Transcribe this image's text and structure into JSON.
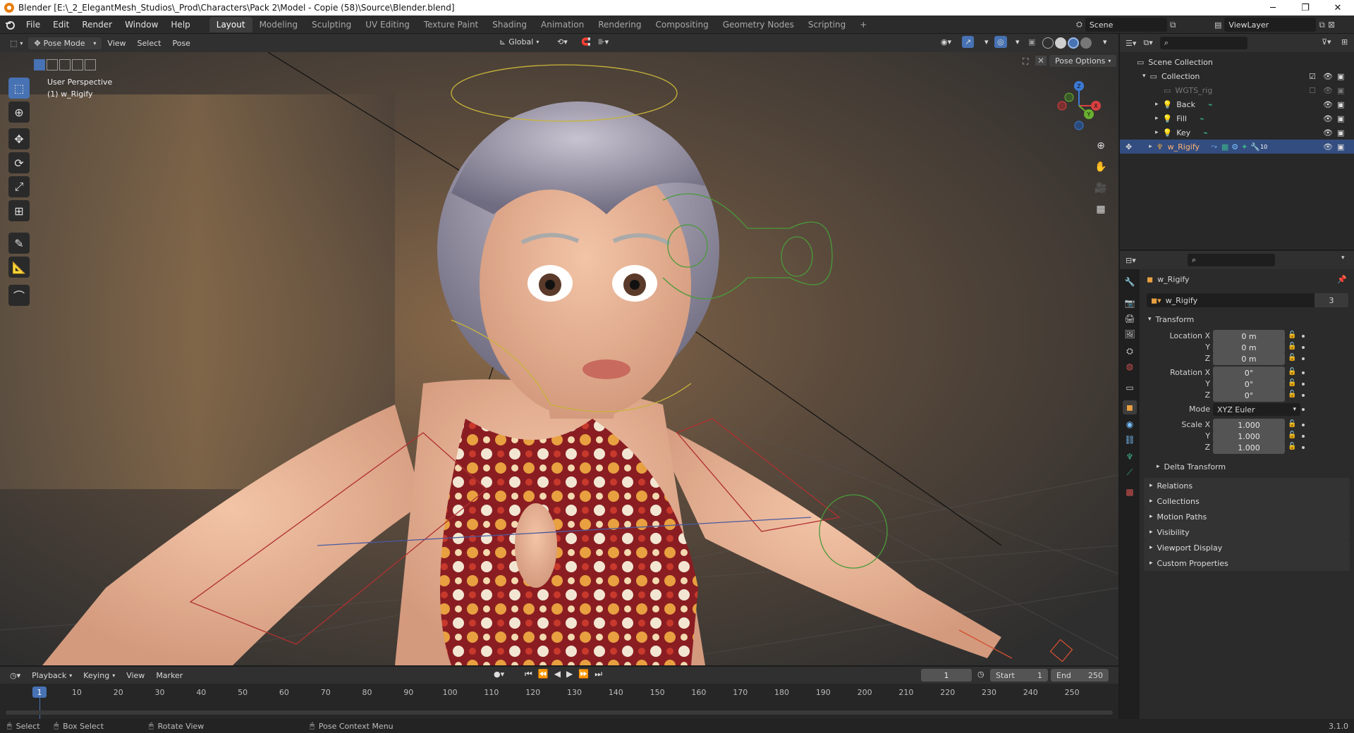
{
  "window": {
    "title": "Blender [E:\\_2_ElegantMesh_Studios\\_Prod\\Characters\\Pack 2\\Model - Copie (58)\\Source\\Blender.blend]",
    "minimize": "─",
    "maximize": "❐",
    "close": "✕"
  },
  "menubar": {
    "menus": [
      "File",
      "Edit",
      "Render",
      "Window",
      "Help"
    ],
    "workspaces": [
      "Layout",
      "Modeling",
      "Sculpting",
      "UV Editing",
      "Texture Paint",
      "Shading",
      "Animation",
      "Rendering",
      "Compositing",
      "Geometry Nodes",
      "Scripting"
    ],
    "active_workspace": "Layout",
    "add_workspace": "+",
    "scene_label": "Scene",
    "view_layer_label": "ViewLayer"
  },
  "viewport_header": {
    "mode": "Pose Mode",
    "menus": [
      "View",
      "Select",
      "Pose"
    ],
    "orientation": "Global",
    "pose_options": "Pose Options"
  },
  "viewport": {
    "perspective_label": "User Perspective",
    "object_label": "(1) w_Rigify",
    "gizmo_axes": [
      "X",
      "Y",
      "Z"
    ]
  },
  "outliner": {
    "root": "Scene Collection",
    "collection": "Collection",
    "items": [
      "WGTS_rig",
      "Back",
      "Fill",
      "Key",
      "w_Rigify"
    ],
    "selected": "w_Rigify",
    "modifier_count": "10"
  },
  "properties": {
    "object_name": "w_Rigify",
    "data_name": "w_Rigify",
    "users": "3",
    "transform_label": "Transform",
    "location_label": "Location X",
    "rotation_label": "Rotation X",
    "scale_label": "Scale X",
    "axis_y": "Y",
    "axis_z": "Z",
    "location": [
      "0 m",
      "0 m",
      "0 m"
    ],
    "rotation": [
      "0°",
      "0°",
      "0°"
    ],
    "mode_label": "Mode",
    "mode_value": "XYZ Euler",
    "scale": [
      "1.000",
      "1.000",
      "1.000"
    ],
    "delta_transform": "Delta Transform",
    "panels": [
      "Relations",
      "Collections",
      "Motion Paths",
      "Visibility",
      "Viewport Display",
      "Custom Properties"
    ]
  },
  "timeline": {
    "menus": [
      "Playback",
      "Keying",
      "View",
      "Marker"
    ],
    "current_frame": "1",
    "start_label": "Start",
    "start": "1",
    "end_label": "End",
    "end": "250",
    "ticks": [
      "10",
      "20",
      "30",
      "40",
      "50",
      "60",
      "70",
      "80",
      "90",
      "100",
      "110",
      "120",
      "130",
      "140",
      "150",
      "160",
      "170",
      "180",
      "190",
      "200",
      "210",
      "220",
      "230",
      "240",
      "250"
    ],
    "playhead": "1"
  },
  "statusbar": {
    "select": "Select",
    "box_select": "Box Select",
    "rotate_view": "Rotate View",
    "context_menu": "Pose Context Menu",
    "version": "3.1.0"
  },
  "colors": {
    "accent": "#4772b3",
    "selected_row": "#334d80",
    "blender_orange": "#e87d0d"
  }
}
